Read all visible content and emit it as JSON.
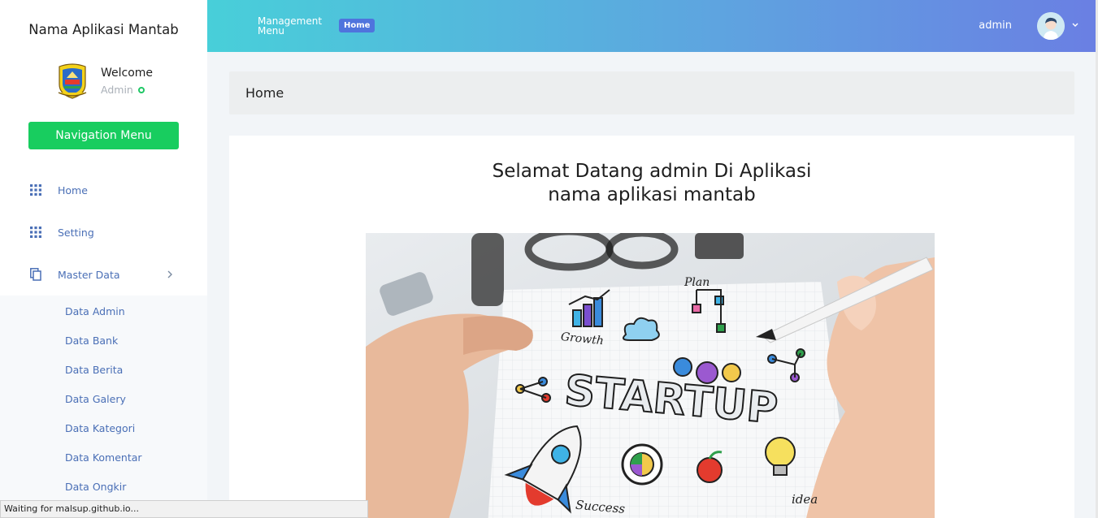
{
  "sidebar": {
    "brand": "Nama Aplikasi Mantab",
    "welcome": "Welcome",
    "role": "Admin",
    "nav_button": "Navigation Menu",
    "menu": [
      {
        "label": "Home",
        "icon": "grid-icon"
      },
      {
        "label": "Setting",
        "icon": "grid-icon"
      },
      {
        "label": "Master Data",
        "icon": "copy-icon"
      }
    ],
    "submenu": [
      "Data Admin",
      "Data Bank",
      "Data Berita",
      "Data Galery",
      "Data Kategori",
      "Data Komentar",
      "Data Ongkir"
    ]
  },
  "header": {
    "management_menu": "Management Menu",
    "home_pill": "Home",
    "user": "admin"
  },
  "main": {
    "breadcrumb": "Home",
    "title_line1": "Selamat Datang admin Di Aplikasi",
    "title_line2": "nama aplikasi mantab",
    "hero": {
      "text_startup": "STARTUP",
      "text_plan": "Plan",
      "text_growth": "Growth",
      "text_success": "Success",
      "text_idea": "idea"
    }
  },
  "statusbar": {
    "text": "Waiting for malsup.github.io..."
  },
  "colors": {
    "accent_green": "#18cd5f",
    "link_blue": "#4a6fb6",
    "header_start": "#48cfd9",
    "header_end": "#6a7fe3"
  }
}
